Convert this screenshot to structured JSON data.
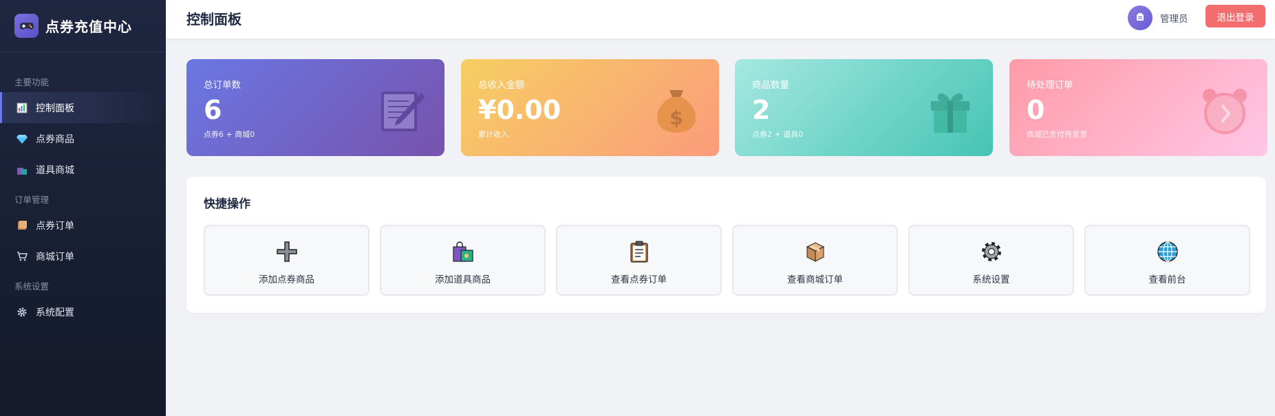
{
  "brand": {
    "title": "点券充值中心",
    "icon": "gamepad-icon"
  },
  "sidebar": {
    "sections": [
      {
        "title": "主要功能",
        "items": [
          {
            "label": "控制面板",
            "icon": "bar-chart-icon",
            "active": true
          },
          {
            "label": "点券商品",
            "icon": "diamond-icon"
          },
          {
            "label": "道具商城",
            "icon": "shopping-bags-icon"
          }
        ]
      },
      {
        "title": "订单管理",
        "items": [
          {
            "label": "点券订单",
            "icon": "book-icon"
          },
          {
            "label": "商城订单",
            "icon": "cart-icon"
          }
        ]
      },
      {
        "title": "系统设置",
        "items": [
          {
            "label": "系统配置",
            "icon": "gear-icon"
          }
        ]
      }
    ]
  },
  "header": {
    "title": "控制面板",
    "user": "管理员",
    "logout": "退出登录"
  },
  "stats": [
    {
      "label": "总订单数",
      "value": "6",
      "sub": "点券6 + 商城0",
      "icon": "memo-icon",
      "color": "#6a77e3"
    },
    {
      "label": "总收入金额",
      "value": "¥0.00",
      "sub": "累计收入",
      "icon": "money-bag-icon",
      "color": "#f6cf62"
    },
    {
      "label": "商品数量",
      "value": "2",
      "sub": "点券2 + 道具0",
      "icon": "gift-icon",
      "color": "#45c4b5"
    },
    {
      "label": "待处理订单",
      "value": "0",
      "sub": "商城已支付待发货",
      "icon": "alarm-clock-icon",
      "color": "#ff9aa7"
    }
  ],
  "quick": {
    "title": "快捷操作",
    "actions": [
      {
        "label": "添加点券商品",
        "icon": "plus-icon"
      },
      {
        "label": "添加道具商品",
        "icon": "shopping-bag-icon"
      },
      {
        "label": "查看点券订单",
        "icon": "clipboard-icon"
      },
      {
        "label": "查看商城订单",
        "icon": "package-icon"
      },
      {
        "label": "系统设置",
        "icon": "gear-icon"
      },
      {
        "label": "查看前台",
        "icon": "globe-icon"
      }
    ]
  },
  "colors": {
    "accent": "#6b78e6",
    "danger": "#f26d6d",
    "sidebar": "#1a2035"
  }
}
